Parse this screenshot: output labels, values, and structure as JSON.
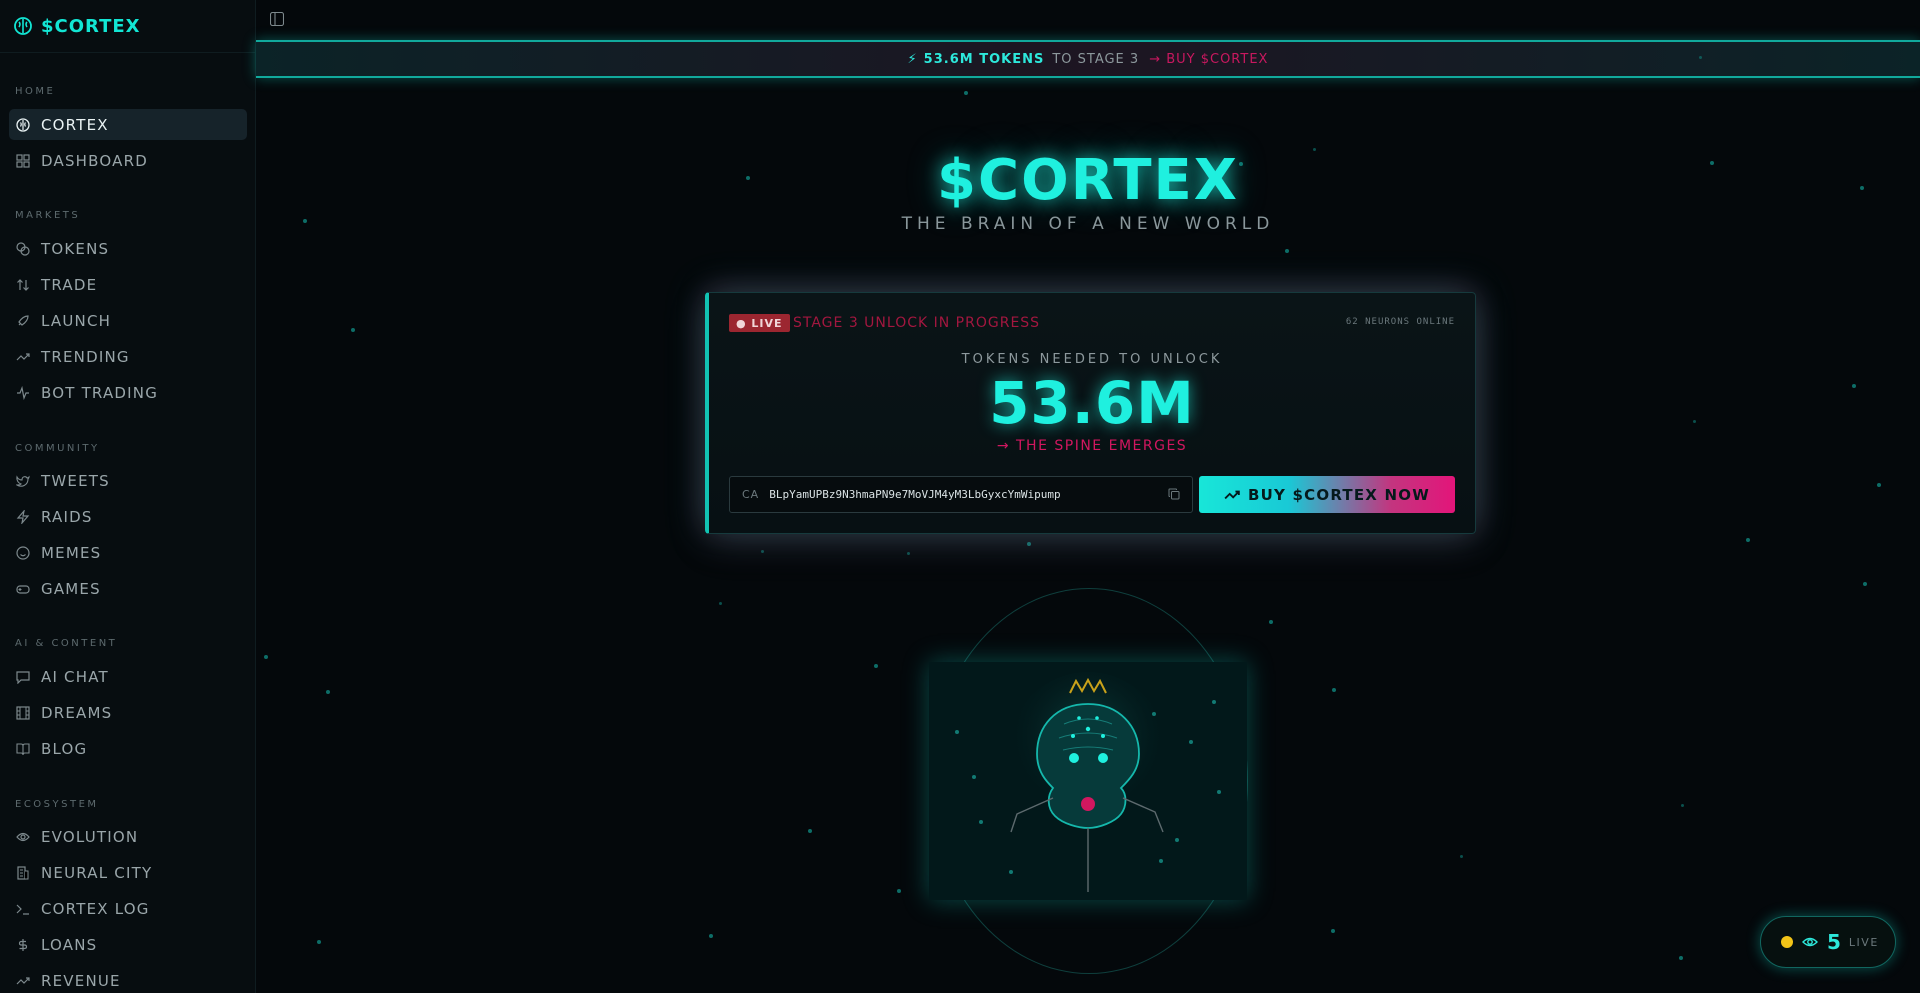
{
  "brand": {
    "name": "$CORTEX",
    "icon": "brain-icon"
  },
  "sidebar": {
    "sections": [
      {
        "label": "HOME",
        "items": [
          {
            "label": "CORTEX",
            "icon": "brain-icon",
            "active": true
          },
          {
            "label": "DASHBOARD",
            "icon": "grid-icon"
          }
        ]
      },
      {
        "label": "MARKETS",
        "items": [
          {
            "label": "TOKENS",
            "icon": "coins-icon"
          },
          {
            "label": "TRADE",
            "icon": "arrows-up-down-icon"
          },
          {
            "label": "LAUNCH",
            "icon": "rocket-icon"
          },
          {
            "label": "TRENDING",
            "icon": "trending-up-icon"
          },
          {
            "label": "BOT TRADING",
            "icon": "activity-icon"
          }
        ]
      },
      {
        "label": "COMMUNITY",
        "items": [
          {
            "label": "TWEETS",
            "icon": "twitter-icon"
          },
          {
            "label": "RAIDS",
            "icon": "zap-icon"
          },
          {
            "label": "MEMES",
            "icon": "smile-icon"
          },
          {
            "label": "GAMES",
            "icon": "gamepad-icon"
          }
        ]
      },
      {
        "label": "AI & CONTENT",
        "items": [
          {
            "label": "AI CHAT",
            "icon": "message-icon"
          },
          {
            "label": "DREAMS",
            "icon": "film-icon"
          },
          {
            "label": "BLOG",
            "icon": "book-icon"
          }
        ]
      },
      {
        "label": "ECOSYSTEM",
        "items": [
          {
            "label": "EVOLUTION",
            "icon": "eye-icon"
          },
          {
            "label": "NEURAL CITY",
            "icon": "building-icon"
          },
          {
            "label": "CORTEX LOG",
            "icon": "terminal-icon"
          },
          {
            "label": "LOANS",
            "icon": "dollar-icon"
          },
          {
            "label": "REVENUE",
            "icon": "trending-up-icon"
          }
        ]
      }
    ]
  },
  "ticker": {
    "amount": "53.6M TOKENS",
    "stage": "TO STAGE 3",
    "buy": "→ BUY $CORTEX"
  },
  "hero": {
    "title": "$CORTEX",
    "subtitle": "THE BRAIN OF A NEW WORLD"
  },
  "card": {
    "live_badge": "● LIVE",
    "status": "STAGE 3 UNLOCK IN PROGRESS",
    "neurons": "62 NEURONS ONLINE",
    "needed_label": "TOKENS NEEDED TO UNLOCK",
    "needed_amount": "53.6M",
    "spine": "→ THE SPINE EMERGES",
    "ca_label": "CA",
    "ca_value": "BLpYamUPBz9N3hmaPN9e7MoVJM4yM3LbGyxcYmWipump",
    "buy_label": "BUY $CORTEX NOW"
  },
  "live_pill": {
    "count": "5",
    "label": "LIVE"
  },
  "colors": {
    "accent": "#1ff0df",
    "pink": "#d1175f",
    "gold": "#f2c418"
  }
}
